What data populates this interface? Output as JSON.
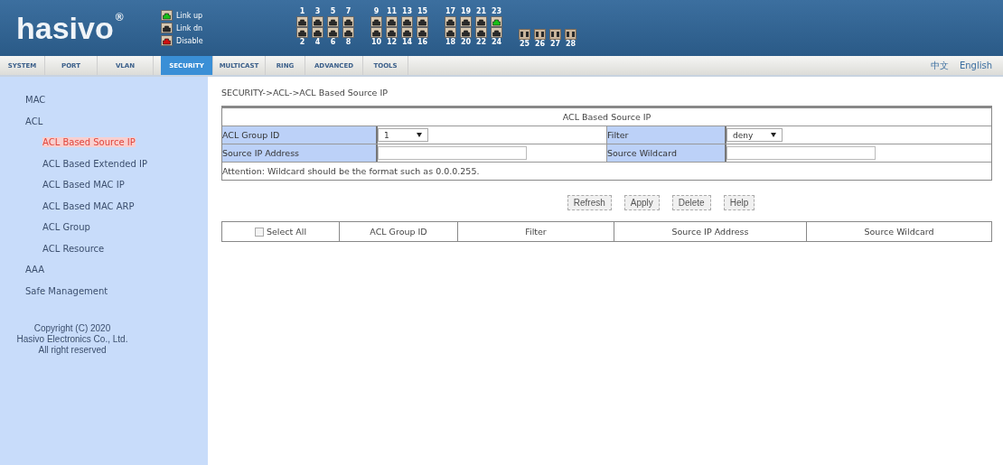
{
  "header": {
    "logo": "hasivo",
    "logo_mark": "®",
    "legend": [
      {
        "label": "Link up",
        "color": "#18c018"
      },
      {
        "label": "Link dn",
        "color": "#2a2a2a"
      },
      {
        "label": "Disable",
        "color": "#d01010"
      }
    ],
    "ports": [
      {
        "number": "1",
        "kind": "copper",
        "color": "#2a2a2a"
      },
      {
        "number": "2",
        "kind": "copper",
        "color": "#2a2a2a"
      },
      {
        "number": "3",
        "kind": "copper",
        "color": "#2a2a2a"
      },
      {
        "number": "4",
        "kind": "copper",
        "color": "#2a2a2a"
      },
      {
        "number": "5",
        "kind": "copper",
        "color": "#2a2a2a"
      },
      {
        "number": "6",
        "kind": "copper",
        "color": "#2a2a2a"
      },
      {
        "number": "7",
        "kind": "copper",
        "color": "#2a2a2a"
      },
      {
        "number": "8",
        "kind": "copper",
        "color": "#2a2a2a"
      },
      {
        "number": "9",
        "kind": "copper",
        "color": "#2a2a2a"
      },
      {
        "number": "10",
        "kind": "copper",
        "color": "#2a2a2a"
      },
      {
        "number": "11",
        "kind": "copper",
        "color": "#2a2a2a"
      },
      {
        "number": "12",
        "kind": "copper",
        "color": "#2a2a2a"
      },
      {
        "number": "13",
        "kind": "copper",
        "color": "#2a2a2a"
      },
      {
        "number": "14",
        "kind": "copper",
        "color": "#2a2a2a"
      },
      {
        "number": "15",
        "kind": "copper",
        "color": "#2a2a2a"
      },
      {
        "number": "16",
        "kind": "copper",
        "color": "#2a2a2a"
      },
      {
        "number": "17",
        "kind": "copper",
        "color": "#2a2a2a"
      },
      {
        "number": "18",
        "kind": "copper",
        "color": "#2a2a2a"
      },
      {
        "number": "19",
        "kind": "copper",
        "color": "#2a2a2a"
      },
      {
        "number": "20",
        "kind": "copper",
        "color": "#2a2a2a"
      },
      {
        "number": "21",
        "kind": "copper",
        "color": "#2a2a2a"
      },
      {
        "number": "22",
        "kind": "copper",
        "color": "#2a2a2a"
      },
      {
        "number": "23",
        "kind": "copper",
        "color": "#18c018"
      },
      {
        "number": "24",
        "kind": "copper",
        "color": "#2a2a2a"
      },
      {
        "number": "25",
        "kind": "fiber",
        "color": "#2a2a2a"
      },
      {
        "number": "26",
        "kind": "fiber",
        "color": "#2a2a2a"
      },
      {
        "number": "27",
        "kind": "fiber",
        "color": "#2a2a2a"
      },
      {
        "number": "28",
        "kind": "fiber",
        "color": "#2a2a2a"
      }
    ]
  },
  "tabs": [
    {
      "label": "SYSTEM",
      "selected": false
    },
    {
      "label": "PORT",
      "selected": false
    },
    {
      "label": "VLAN",
      "selected": false
    },
    {
      "label": "SECURITY",
      "selected": true
    },
    {
      "label": "MULTICAST",
      "selected": false
    },
    {
      "label": "RING",
      "selected": false
    },
    {
      "label": "ADVANCED",
      "selected": false
    },
    {
      "label": "TOOLS",
      "selected": false
    }
  ],
  "languages": [
    "中文",
    "English"
  ],
  "sidebar": {
    "items": [
      {
        "label": "MAC",
        "selected": false
      },
      {
        "label": "ACL",
        "selected": false,
        "children": [
          {
            "label": "ACL Based Source IP",
            "selected": true
          },
          {
            "label": "ACL Based Extended IP",
            "selected": false
          },
          {
            "label": "ACL Based MAC IP",
            "selected": false
          },
          {
            "label": "ACL Based MAC ARP",
            "selected": false
          },
          {
            "label": "ACL Group",
            "selected": false
          },
          {
            "label": "ACL Resource",
            "selected": false
          }
        ]
      },
      {
        "label": "AAA",
        "selected": false
      },
      {
        "label": "Safe Management",
        "selected": false
      }
    ],
    "copyright": [
      "Copyright (C) 2020",
      "Hasivo Electronics Co., Ltd.",
      "All right reserved"
    ]
  },
  "breadcrumb": "SECURITY->ACL->ACL Based Source IP",
  "form": {
    "title": "ACL Based Source IP",
    "rows": [
      [
        {
          "label": "ACL Group ID",
          "kind": "select",
          "value": "1"
        },
        {
          "label": "Filter",
          "kind": "select",
          "value": "deny"
        }
      ],
      [
        {
          "label": "Source IP Address",
          "kind": "input"
        },
        {
          "label": "Source Wildcard",
          "kind": "input"
        }
      ]
    ],
    "note": "Attention: Wildcard should be the format such as 0.0.0.255."
  },
  "buttons": [
    "Refresh",
    "Apply",
    "Delete",
    "Help"
  ],
  "table": {
    "select_all": {
      "label": "Select All",
      "checked": false
    },
    "columns": [
      "ACL Group ID",
      "Filter",
      "Source IP Address",
      "Source Wildcard"
    ]
  }
}
